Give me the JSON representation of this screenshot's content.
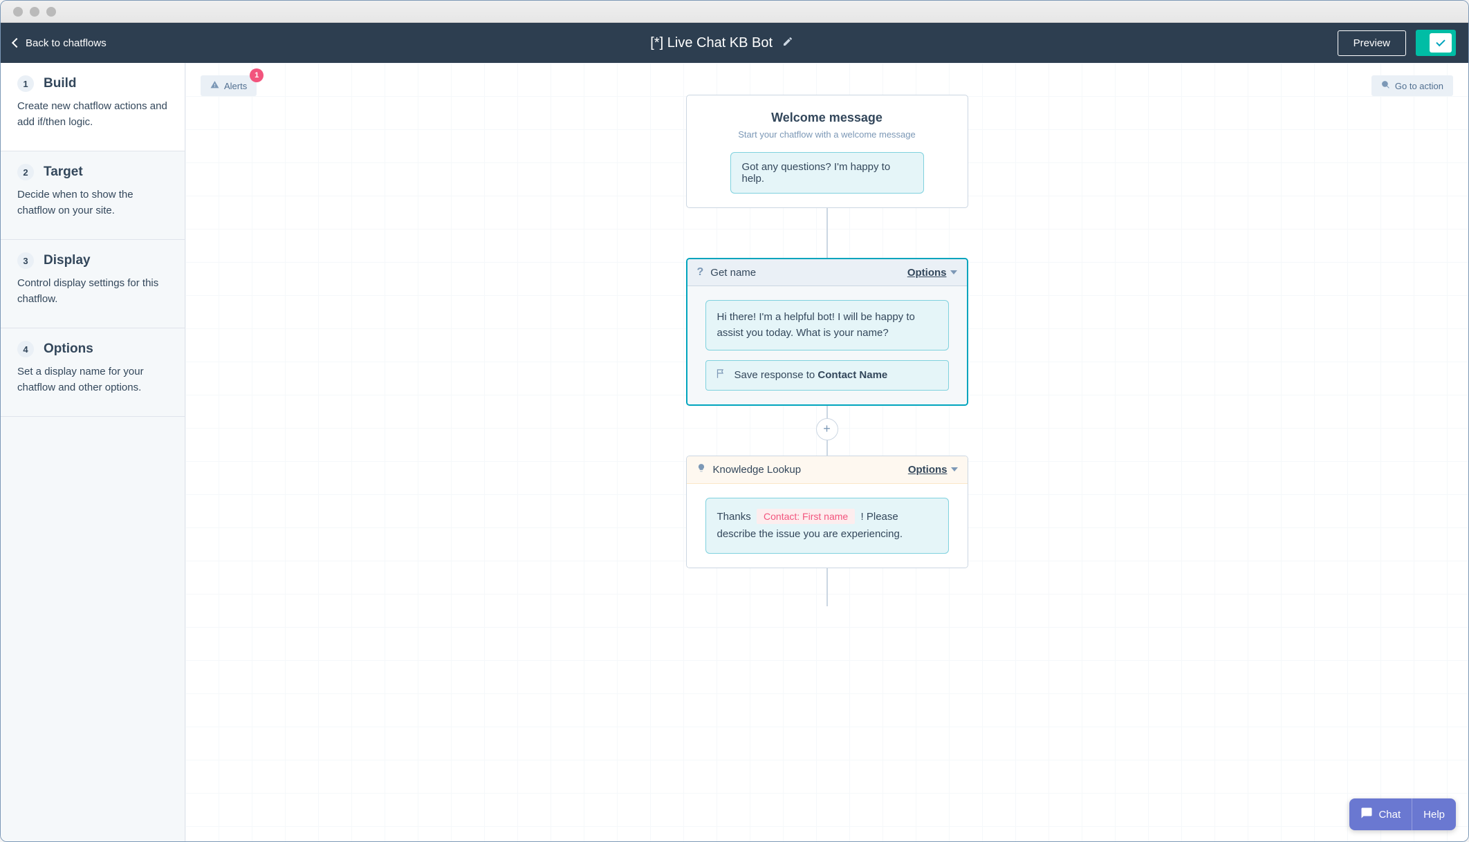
{
  "header": {
    "back_label": "Back to chatflows",
    "title": "[*] Live Chat KB Bot",
    "preview_label": "Preview"
  },
  "sidebar": {
    "items": [
      {
        "num": "1",
        "title": "Build",
        "desc": "Create new chatflow actions and add if/then logic."
      },
      {
        "num": "2",
        "title": "Target",
        "desc": "Decide when to show the chatflow on your site."
      },
      {
        "num": "3",
        "title": "Display",
        "desc": "Control display settings for this chatflow."
      },
      {
        "num": "4",
        "title": "Options",
        "desc": "Set a display name for your chatflow and other options."
      }
    ]
  },
  "canvas": {
    "alerts_label": "Alerts",
    "alerts_count": "1",
    "goto_label": "Go to action"
  },
  "flow": {
    "welcome": {
      "title": "Welcome message",
      "subtitle": "Start your chatflow with a welcome message",
      "bubble": "Got any questions? I'm happy to help."
    },
    "get_name": {
      "title": "Get name",
      "options_label": "Options",
      "bubble": "Hi there! I'm a helpful bot!  I will be happy to assist you today. What is your name?",
      "save_prefix": "Save response to ",
      "save_target": "Contact Name"
    },
    "knowledge": {
      "title": "Knowledge Lookup",
      "options_label": "Options",
      "pre": "Thanks ",
      "token": "Contact: First name",
      "post": " ! Please describe the issue you are experiencing."
    }
  },
  "chat_pill": {
    "chat_label": "Chat",
    "help_label": "Help"
  }
}
